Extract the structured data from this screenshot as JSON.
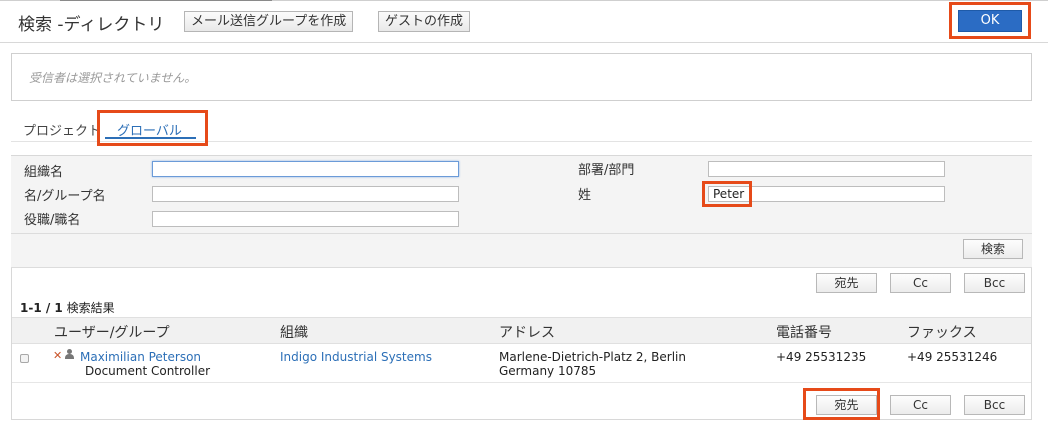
{
  "header": {
    "title": "検索 ‐ディレクトリ",
    "create_group_label": "メール送信グループを作成",
    "create_guest_label": "ゲストの作成",
    "ok_label": "OK"
  },
  "recipients": {
    "empty_text": "受信者は選択されていません。"
  },
  "tabs": [
    {
      "label": "プロジェクト",
      "active": false
    },
    {
      "label": "グローバル",
      "active": true
    }
  ],
  "form": {
    "org_name_label": "組織名",
    "org_name_value": "",
    "first_name_label": "名/グループ名",
    "first_name_value": "",
    "job_title_label": "役職/職名",
    "job_title_value": "",
    "department_label": "部署/部門",
    "department_value": "",
    "last_name_label": "姓",
    "last_name_value": "Peter"
  },
  "search_label": "検索",
  "actions": {
    "to_label": "宛先",
    "cc_label": "Cc",
    "bcc_label": "Bcc"
  },
  "results": {
    "range": "1‐1 / 1",
    "suffix": "検索結果",
    "columns": [
      "ユーザー/グループ",
      "組織",
      "アドレス",
      "電話番号",
      "ファックス"
    ],
    "rows": [
      {
        "name": "Maximilian Peterson",
        "role": "Document Controller",
        "organization": "Indigo Industrial Systems",
        "address_line1": "Marlene-Dietrich-Platz 2, Berlin",
        "address_line2": "Germany 10785",
        "phone": "+49 25531235",
        "fax": "+49 25531246"
      }
    ]
  },
  "colors": {
    "primary": "#2b6cc4",
    "link": "#2c6fb7",
    "highlight": "#e64a19"
  },
  "icons": {
    "remove": "x-icon",
    "user": "person-icon"
  }
}
